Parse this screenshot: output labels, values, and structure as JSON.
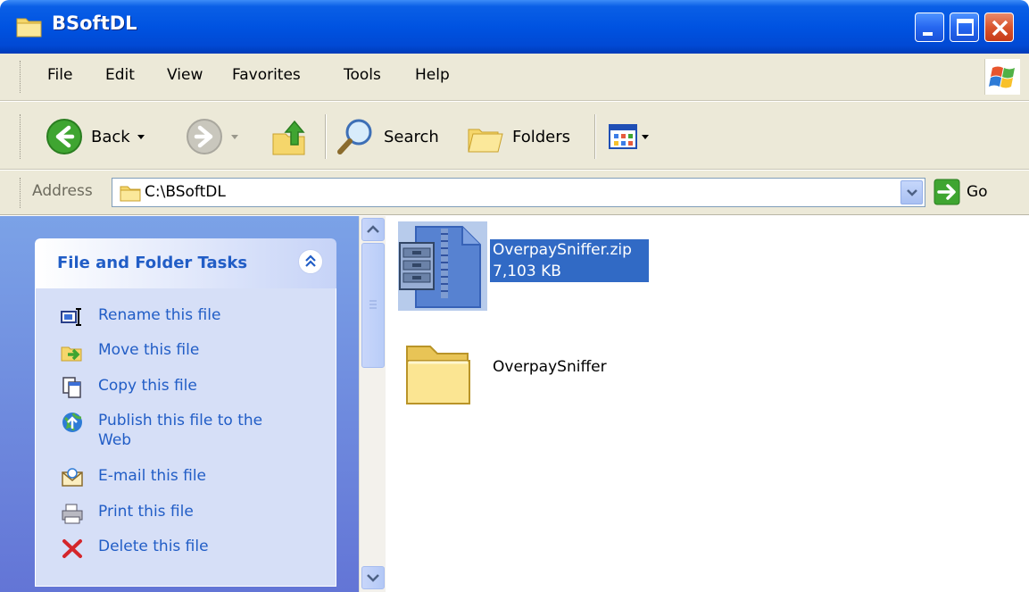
{
  "window": {
    "title": "BSoftDL"
  },
  "menu": [
    "File",
    "Edit",
    "View",
    "Favorites",
    "Tools",
    "Help"
  ],
  "toolbar": {
    "back": "Back",
    "search": "Search",
    "folders": "Folders"
  },
  "address": {
    "label": "Address",
    "value": "C:\\BSoftDL",
    "go": "Go"
  },
  "tasks": {
    "title": "File and Folder Tasks",
    "items": [
      {
        "label": "Rename this file",
        "icon": "rename-icon"
      },
      {
        "label": "Move this file",
        "icon": "move-icon"
      },
      {
        "label": "Copy this file",
        "icon": "copy-icon"
      },
      {
        "label": "Publish this file to the Web",
        "icon": "publish-icon"
      },
      {
        "label": "E-mail this file",
        "icon": "email-icon"
      },
      {
        "label": "Print this file",
        "icon": "print-icon"
      },
      {
        "label": "Delete this file",
        "icon": "delete-icon"
      }
    ]
  },
  "files": [
    {
      "name": "OverpaySniffer.zip",
      "size": "7,103 KB",
      "selected": true,
      "icon": "zip-archive-icon"
    },
    {
      "name": "OverpaySniffer",
      "selected": false,
      "icon": "folder-icon"
    }
  ],
  "colors": {
    "titlebar": "#0053e1",
    "selection": "#316ac5",
    "taskLink": "#215dc6"
  }
}
